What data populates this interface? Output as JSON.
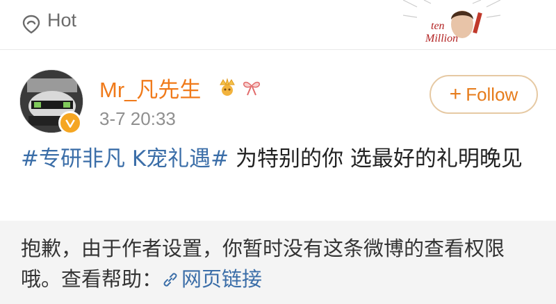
{
  "header": {
    "hot_label": "Hot"
  },
  "sticker": {
    "text_line1": "ten",
    "text_line2": "Million"
  },
  "post": {
    "username": "Mr_凡先生",
    "timestamp": "3-7 20:33",
    "follow_label": "Follow",
    "hashtag": "#专研非凡 K宠礼遇#",
    "body": " 为特别的你 选最好的礼明晚见"
  },
  "restricted": {
    "message": "抱歉，由于作者设置，你暂时没有这条微博的查看权限哦。查看帮助：",
    "help_link": "网页链接"
  }
}
